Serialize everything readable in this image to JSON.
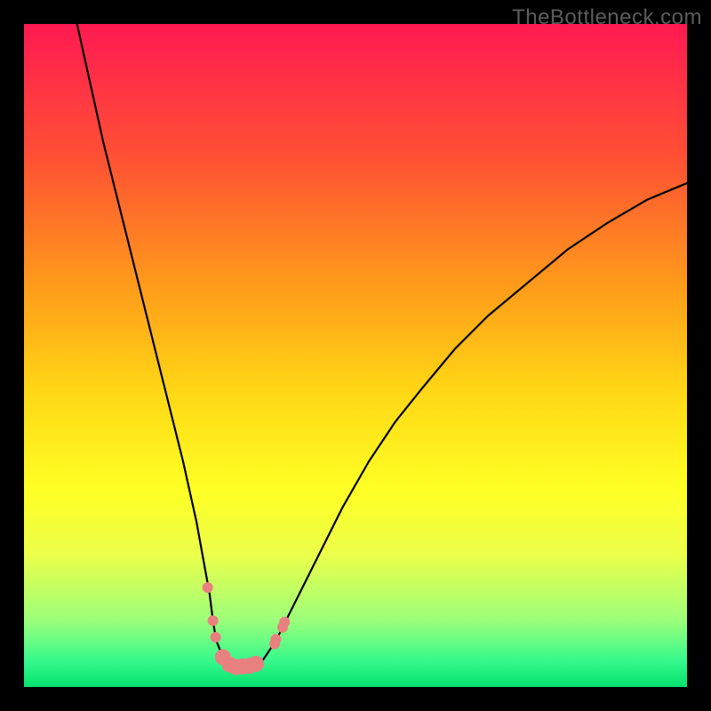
{
  "watermark": "TheBottleneck.com",
  "chart_data": {
    "type": "line",
    "title": "",
    "xlabel": "",
    "ylabel": "",
    "xlim": [
      0,
      100
    ],
    "ylim": [
      0,
      100
    ],
    "grid": false,
    "legend": false,
    "background_gradient_stops": [
      {
        "pos": 0,
        "color": "#ff1a52"
      },
      {
        "pos": 20,
        "color": "#ff5034"
      },
      {
        "pos": 40,
        "color": "#ff9d1a"
      },
      {
        "pos": 55,
        "color": "#ffd615"
      },
      {
        "pos": 70,
        "color": "#ffff24"
      },
      {
        "pos": 80,
        "color": "#ecff4a"
      },
      {
        "pos": 90,
        "color": "#9bff7a"
      },
      {
        "pos": 96,
        "color": "#37f98c"
      },
      {
        "pos": 100,
        "color": "#04e26e"
      }
    ],
    "series": [
      {
        "name": "bottleneck-curve",
        "color": "#000000",
        "x": [
          8,
          10,
          12,
          14,
          16,
          18,
          20,
          22,
          24,
          26,
          28,
          28.5,
          29,
          30,
          31,
          32,
          32.5,
          33,
          34,
          35,
          36,
          38,
          40,
          42,
          45,
          48,
          52,
          56,
          60,
          65,
          70,
          76,
          82,
          88,
          94,
          100
        ],
        "y": [
          100,
          91,
          82,
          74,
          66,
          58,
          50,
          42,
          34,
          25,
          14,
          10,
          7,
          4.5,
          3.2,
          3.0,
          3.0,
          3.1,
          3.2,
          3.5,
          4,
          7,
          11,
          15,
          21,
          27,
          34,
          40,
          45,
          51,
          56,
          61,
          66,
          70,
          73.5,
          76
        ]
      }
    ],
    "markers": {
      "name": "highlighted-points",
      "color": "#e98080",
      "radius_small": 6,
      "radius_large": 9,
      "points": [
        {
          "x": 27.7,
          "y": 15,
          "r": "small"
        },
        {
          "x": 28.5,
          "y": 10,
          "r": "small"
        },
        {
          "x": 28.9,
          "y": 7.5,
          "r": "small"
        },
        {
          "x": 30.0,
          "y": 4.5,
          "r": "large"
        },
        {
          "x": 31.0,
          "y": 3.4,
          "r": "large"
        },
        {
          "x": 32.0,
          "y": 3.0,
          "r": "large"
        },
        {
          "x": 33.0,
          "y": 3.1,
          "r": "large"
        },
        {
          "x": 34.0,
          "y": 3.2,
          "r": "large"
        },
        {
          "x": 35.0,
          "y": 3.5,
          "r": "large"
        },
        {
          "x": 37.8,
          "y": 6.5,
          "r": "small"
        },
        {
          "x": 38.0,
          "y": 7.2,
          "r": "small"
        },
        {
          "x": 39.0,
          "y": 9.0,
          "r": "small"
        },
        {
          "x": 39.3,
          "y": 9.8,
          "r": "small"
        }
      ]
    }
  }
}
